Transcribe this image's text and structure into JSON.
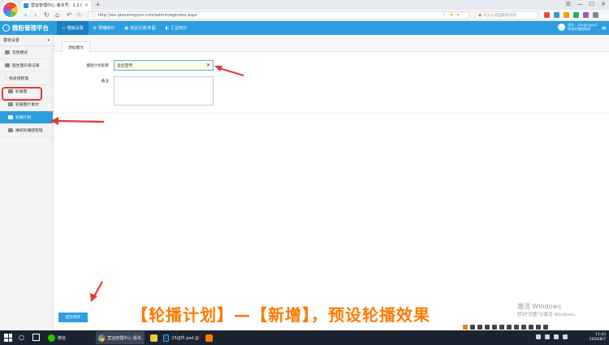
{
  "browser": {
    "tab_title": "营运管理中心 版本号：1.2.0",
    "tab_close": "×",
    "new_tab": "+",
    "url": "http://wx.qianmingyun.com/admin/wgindex.aspx",
    "search_placeholder": "双分火箭国家税务网",
    "window_controls": [
      "☰",
      "—",
      "☐",
      "✕"
    ]
  },
  "app": {
    "brand": "微粉管理平台",
    "nav": [
      {
        "label": "模板设置"
      },
      {
        "label": "预播统计"
      },
      {
        "label": "淘宝引流/多图"
      },
      {
        "label": "汇总统计"
      }
    ],
    "user_line1": "您好，yangangyu2",
    "user_line2": "快速轮播图管理"
  },
  "sidebar": {
    "header": "模板设置",
    "items": [
      {
        "label": "在售模式"
      },
      {
        "label": "图生图升级记录"
      },
      {
        "label": "快递组管理"
      },
      {
        "label": "轮播图"
      },
      {
        "label": "轮播图片素材"
      },
      {
        "label": "轮播计划"
      },
      {
        "label": "维权轮播图管理"
      }
    ]
  },
  "main": {
    "tab": "添加图文",
    "name_label": "播放计划名称",
    "name_value": "企业宣传",
    "remark_label": "备注",
    "submit": "提交保存"
  },
  "overlay": {
    "caption": "【轮播计划】—【新增】，预设轮播效果",
    "watermark_line1": "激活 Windows",
    "watermark_line2": "转到\"设置\"以激活 Windows。"
  },
  "taskbar": {
    "apps": [
      {
        "label": "微信"
      },
      {
        "label": "营运管理中心 版本..."
      },
      {
        "label": ""
      },
      {
        "label": "25证件.psd @ 95..."
      },
      {
        "label": ""
      }
    ],
    "time": "11:43",
    "date": "2020/8/7"
  },
  "colors": {
    "accent": "#2c9ee0",
    "arrow": "#e53935",
    "caption": "#ff7a00"
  }
}
